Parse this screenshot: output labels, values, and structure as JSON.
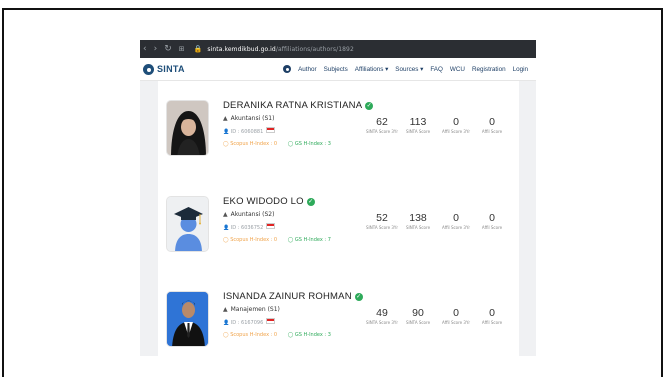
{
  "browser": {
    "url_host": "sinta.kemdikbud.go.id",
    "url_path": "/affiliations/authors/1892"
  },
  "site": {
    "logo": "SINTA"
  },
  "nav": {
    "items": [
      "Author",
      "Subjects",
      "Affiliations ▾",
      "Sources ▾",
      "FAQ",
      "WCU",
      "Registration",
      "Login"
    ]
  },
  "authors": [
    {
      "name": "DERANIKA RATNA KRISTIANA",
      "dept": "Akuntansi (S1)",
      "id": "ID : 6060881",
      "scopus": "Scopus H-Index : 0",
      "gs": "GS H-Index : 3",
      "stats": [
        {
          "v": "62",
          "l": "SINTA Score 3Yr"
        },
        {
          "v": "113",
          "l": "SINTA Score"
        },
        {
          "v": "0",
          "l": "Affil Score 3Yr"
        },
        {
          "v": "0",
          "l": "Affil Score"
        }
      ]
    },
    {
      "name": "EKO WIDODO LO",
      "dept": "Akuntansi (S2)",
      "id": "ID : 6036752",
      "scopus": "Scopus H-Index : 0",
      "gs": "GS H-Index : 7",
      "stats": [
        {
          "v": "52",
          "l": "SINTA Score 3Yr"
        },
        {
          "v": "138",
          "l": "SINTA Score"
        },
        {
          "v": "0",
          "l": "Affil Score 3Yr"
        },
        {
          "v": "0",
          "l": "Affil Score"
        }
      ]
    },
    {
      "name": "ISNANDA ZAINUR ROHMAN",
      "dept": "Manajemen (S1)",
      "id": "ID : 6167096",
      "scopus": "Scopus H-Index : 0",
      "gs": "GS H-Index : 3",
      "stats": [
        {
          "v": "49",
          "l": "SINTA Score 3Yr"
        },
        {
          "v": "90",
          "l": "SINTA Score"
        },
        {
          "v": "0",
          "l": "Affil Score 3Yr"
        },
        {
          "v": "0",
          "l": "Affil Score"
        }
      ]
    }
  ],
  "colors": {
    "brand": "#1e4e79",
    "verified": "#2eaa5a",
    "scopus": "#f0a34a"
  }
}
